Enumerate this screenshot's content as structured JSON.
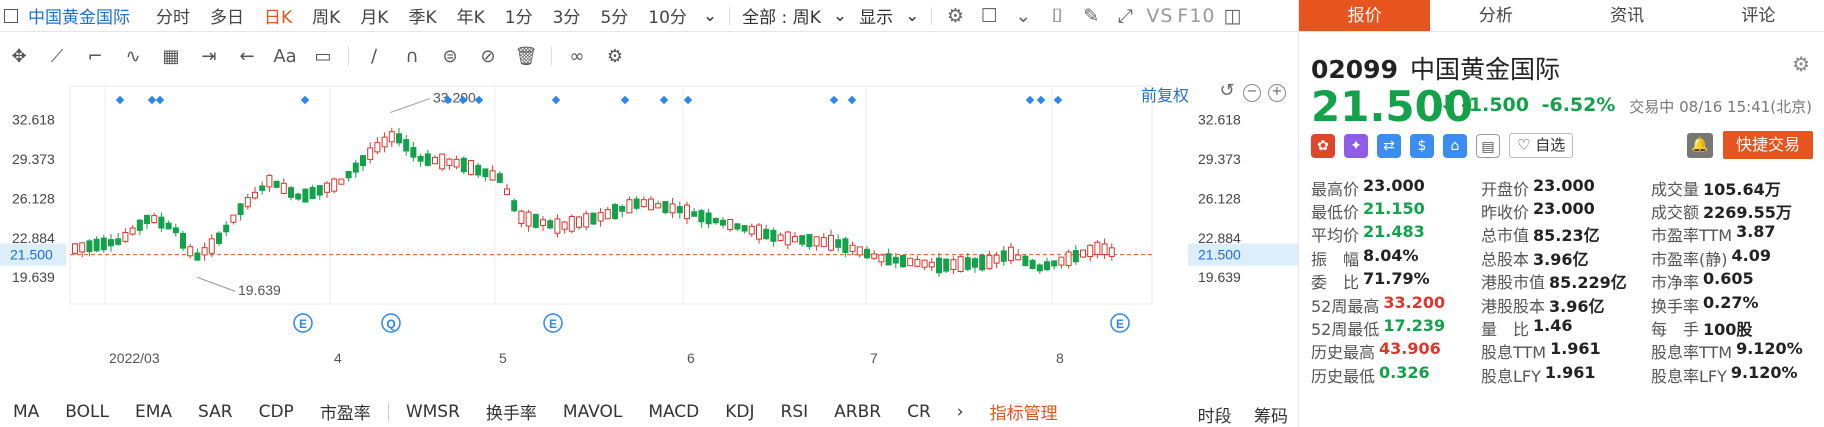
{
  "topbar": {
    "stock_name": "中国黄金国际",
    "timeframes": [
      "分时",
      "多日",
      "日K",
      "周K",
      "月K",
      "季K",
      "年K",
      "1分",
      "3分",
      "5分",
      "10分"
    ],
    "active_timeframe_index": 2,
    "range_select": "全部 : 周K",
    "display_select": "显示",
    "vs_label": "VS",
    "f10_label": "F10"
  },
  "chart": {
    "fuquan_label": "前复权",
    "left_axis": [
      "32.618",
      "29.373",
      "26.128",
      "22.884",
      "21.500",
      "19.639"
    ],
    "right_axis": [
      "32.618",
      "29.373",
      "26.128",
      "22.884",
      "21.500",
      "19.639"
    ],
    "current_price_label": "21.500",
    "high_annotation": "33.200",
    "low_annotation": "19.639",
    "x_labels": [
      "2022/03",
      "4",
      "5",
      "6",
      "7",
      "8"
    ],
    "event_markers": [
      "E",
      "Q",
      "E",
      "E"
    ]
  },
  "chart_data": {
    "type": "candlestick",
    "title": "",
    "y_ticks": [
      32.618,
      29.373,
      26.128,
      22.884,
      19.639
    ],
    "last_price": 21.5,
    "period_high": 33.2,
    "period_low": 19.639,
    "x_ticks": [
      "2022/03",
      "4",
      "5",
      "6",
      "7",
      "8"
    ]
  },
  "indicators": {
    "items": [
      "MA",
      "BOLL",
      "EMA",
      "SAR",
      "CDP",
      "市盈率",
      "WMSR",
      "换手率",
      "MAVOL",
      "MACD",
      "KDJ",
      "RSI",
      "ARBR",
      "CR"
    ],
    "manager": "指标管理",
    "right": [
      "时段",
      "筹码"
    ]
  },
  "panel": {
    "tabs": [
      "报价",
      "分析",
      "资讯",
      "评论"
    ],
    "code": "02099",
    "name": "中国黄金国际",
    "price": "21.500",
    "change": "-1.500",
    "change_pct": "-6.52%",
    "status": "交易中 08/16 15:41(北京)",
    "zixuan": "自选",
    "quick_trade": "快捷交易",
    "stats": [
      [
        {
          "label": "最高价",
          "value": "23.000",
          "color": "plain"
        },
        {
          "label": "开盘价",
          "value": "23.000",
          "color": "plain"
        },
        {
          "label": "成交量",
          "value": "105.64万",
          "color": "plain"
        }
      ],
      [
        {
          "label": "最低价",
          "value": "21.150",
          "color": "green"
        },
        {
          "label": "昨收价",
          "value": "23.000",
          "color": "plain"
        },
        {
          "label": "成交额",
          "value": "2269.55万",
          "color": "plain"
        }
      ],
      [
        {
          "label": "平均价",
          "value": "21.483",
          "color": "green"
        },
        {
          "label": "总市值",
          "value": "85.23亿",
          "color": "plain"
        },
        {
          "label": "市盈率TTM",
          "value": "3.87",
          "color": "plain"
        }
      ],
      [
        {
          "label": "振　幅",
          "value": "8.04%",
          "color": "plain"
        },
        {
          "label": "总股本",
          "value": "3.96亿",
          "color": "plain"
        },
        {
          "label": "市盈率(静)",
          "value": "4.09",
          "color": "plain"
        }
      ],
      [
        {
          "label": "委　比",
          "value": "71.79%",
          "color": "plain"
        },
        {
          "label": "港股市值",
          "value": "85.229亿",
          "color": "plain"
        },
        {
          "label": "市净率",
          "value": "0.605",
          "color": "plain"
        }
      ],
      [
        {
          "label": "52周最高",
          "value": "33.200",
          "color": "red"
        },
        {
          "label": "港股股本",
          "value": "3.96亿",
          "color": "plain"
        },
        {
          "label": "换手率",
          "value": "0.27%",
          "color": "plain"
        }
      ],
      [
        {
          "label": "52周最低",
          "value": "17.239",
          "color": "green"
        },
        {
          "label": "量　比",
          "value": "1.46",
          "color": "plain"
        },
        {
          "label": "每　手",
          "value": "100股",
          "color": "plain"
        }
      ],
      [
        {
          "label": "历史最高",
          "value": "43.906",
          "color": "red"
        },
        {
          "label": "股息TTM",
          "value": "1.961",
          "color": "plain"
        },
        {
          "label": "股息率TTM",
          "value": "9.120%",
          "color": "plain"
        }
      ],
      [
        {
          "label": "历史最低",
          "value": "0.326",
          "color": "green"
        },
        {
          "label": "股息LFY",
          "value": "1.961",
          "color": "plain"
        },
        {
          "label": "股息率LFY",
          "value": "9.120%",
          "color": "plain"
        }
      ]
    ]
  },
  "colors": {
    "accent": "#e8541e",
    "up": "#e0362c",
    "down": "#13a24a",
    "link": "#1e6fd9"
  }
}
